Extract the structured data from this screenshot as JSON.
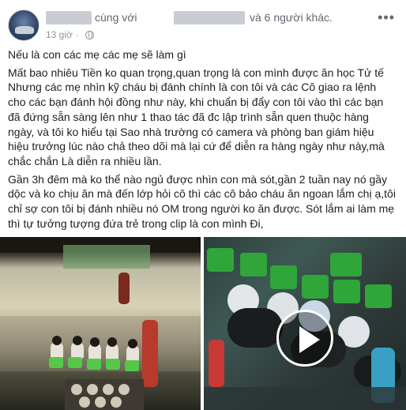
{
  "header": {
    "with_text": "cùng với",
    "others_text": "và 6 người khác.",
    "time": "13 giờ",
    "privacy_icon": "globe-icon",
    "more_icon": "more-icon"
  },
  "post": {
    "lines": [
      "Nếu là con các mẹ các mẹ sẽ làm gì",
      "Mất bao nhiêu Tiền ko quan trọng,quan trọng là con mình được ăn học Tử tế",
      "Nhưng các mẹ nhìn kỹ cháu bị đánh chính là con tôi và các Cô giao ra lệnh",
      "cho các bạn đánh hội đồng như này, khi chuẩn bị đẩy con tôi vào thì các bạn",
      "đã đứng sẵn sàng lên như 1 thao tác đã đc lập trình sẵn quen thuộc hàng",
      "ngày, và tôi ko hiểu tại Sao nhà trường có camera và phòng ban giám hiệu",
      "hiệu trưởng lúc nào chả theo dõi mà lại cứ để diễn ra hàng ngày như này,mà",
      "chắc chắn Là diễn ra nhiều lần.",
      "Gần 3h đêm mà ko thể nào ngủ được nhìn con mà sót,gần 2 tuần nay nó gầy",
      "dộc và ko chịu ăn mà đến lớp hỏi cô thì các cô bảo cháu ăn ngoan lắm chị ạ,tôi",
      "chỉ sợ con tôi bị đánh nhiều nó OM trong người ko ăn được. Sót lắm ai làm mẹ",
      "thì tự tưởng tượng đứa trẻ trong clip là con mình Đi,"
    ]
  },
  "media": {
    "left_label": "classroom-photo",
    "right_label": "video-thumbnail",
    "play_icon": "play-icon"
  },
  "colors": {
    "text": "#1c1e21",
    "meta": "#90949c",
    "header_text": "#616770"
  }
}
